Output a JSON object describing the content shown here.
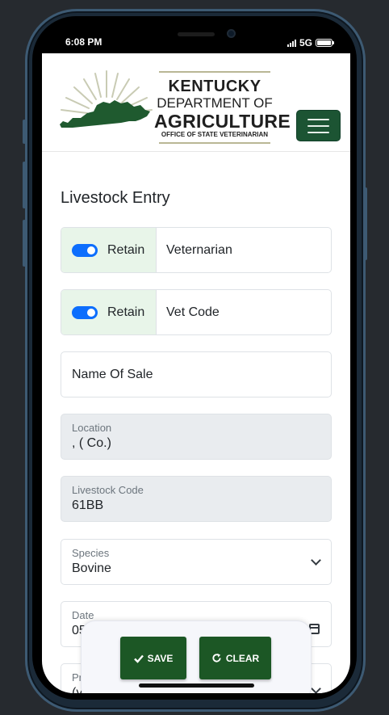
{
  "status_bar": {
    "time": "6:08 PM",
    "network": "5G"
  },
  "header": {
    "logo": {
      "line1": "KENTUCKY",
      "line2": "DEPARTMENT OF",
      "line3": "AGRICULTURE",
      "line4": "OFFICE OF STATE VETERINARIAN"
    },
    "menu_icon": "hamburger-icon"
  },
  "page": {
    "title": "Livestock Entry"
  },
  "form": {
    "veterinarian": {
      "toggle_label": "Retain",
      "toggle_on": true,
      "value": "Veternarian"
    },
    "vet_code": {
      "toggle_label": "Retain",
      "toggle_on": true,
      "value": "Vet Code"
    },
    "name_of_sale": {
      "value": "Name Of Sale"
    },
    "location": {
      "label": "Location",
      "value": ",  ( Co.)"
    },
    "livestock_code": {
      "label": "Livestock Code",
      "value": "61BB"
    },
    "species": {
      "label": "Species",
      "value": "Bovine"
    },
    "date": {
      "label": "Date",
      "value": "05"
    },
    "next_field": {
      "label": "Pr",
      "value": "(v"
    }
  },
  "actions": {
    "save_label": "SAVE",
    "clear_label": "CLEAR"
  },
  "colors": {
    "accent_green": "#1c5433",
    "toggle_blue": "#0d6efd",
    "retain_bg": "#e8f5e9"
  }
}
